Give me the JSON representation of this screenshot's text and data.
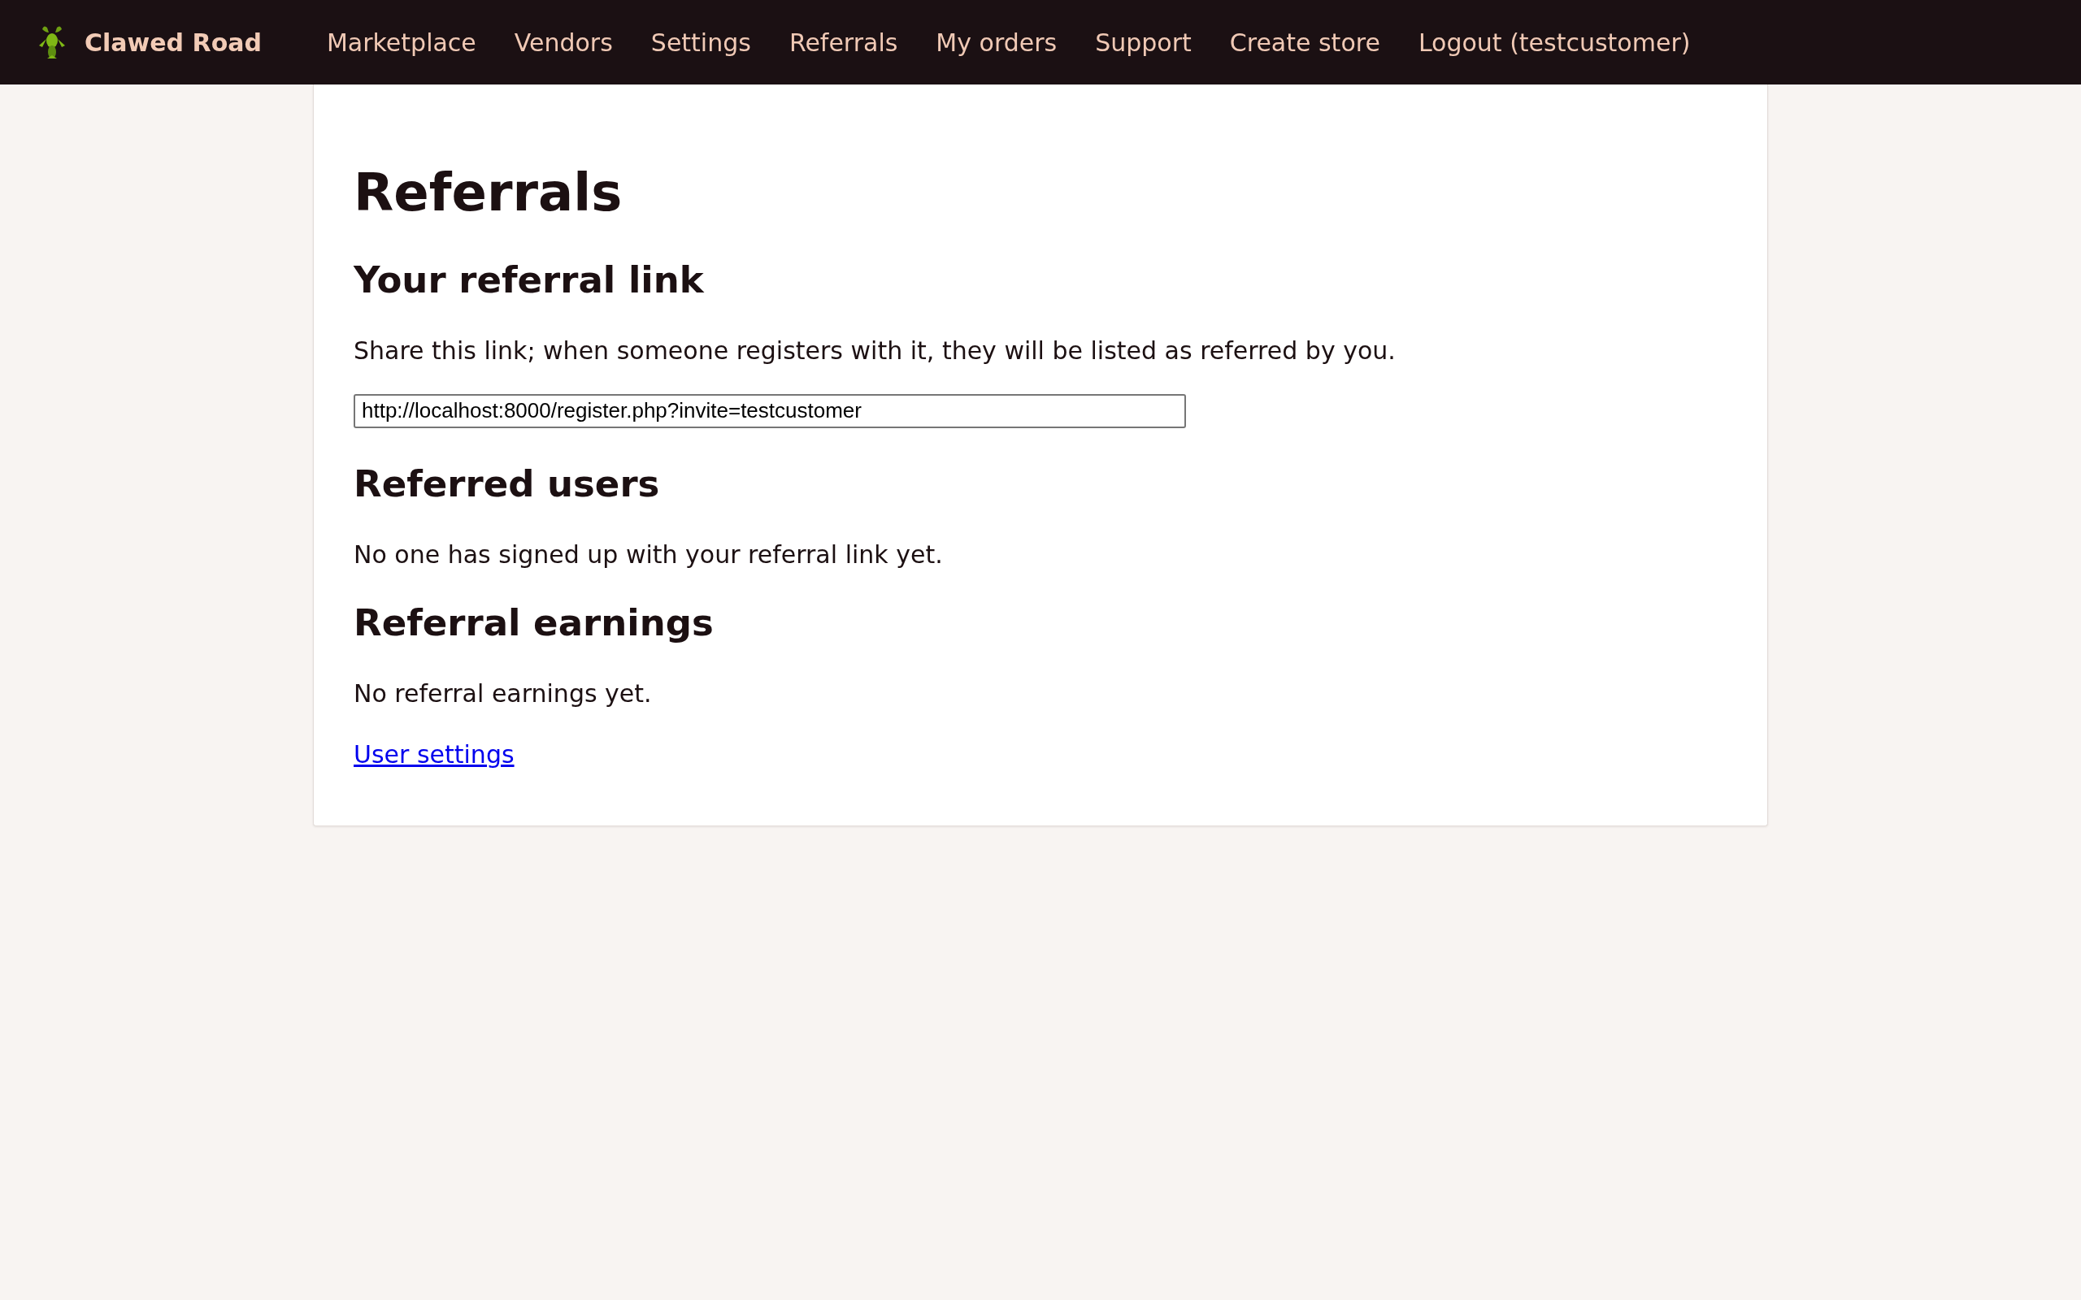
{
  "nav": {
    "brand": "Clawed Road",
    "items": [
      {
        "label": "Marketplace"
      },
      {
        "label": "Vendors"
      },
      {
        "label": "Settings"
      },
      {
        "label": "Referrals"
      },
      {
        "label": "My orders"
      },
      {
        "label": "Support"
      },
      {
        "label": "Create store"
      },
      {
        "label": "Logout (testcustomer)"
      }
    ]
  },
  "page": {
    "title": "Referrals",
    "sections": [
      {
        "kind": "link",
        "heading": "Your referral link",
        "text": "Share this link; when someone registers with it, they will be listed as referred by you.",
        "value": "http://localhost:8000/register.php?invite=testcustomer"
      },
      {
        "kind": "text",
        "heading": "Referred users",
        "text": "No one has signed up with your referral link yet."
      },
      {
        "kind": "text",
        "heading": "Referral earnings",
        "text": "No referral earnings yet."
      }
    ],
    "footer_link": "User settings"
  }
}
